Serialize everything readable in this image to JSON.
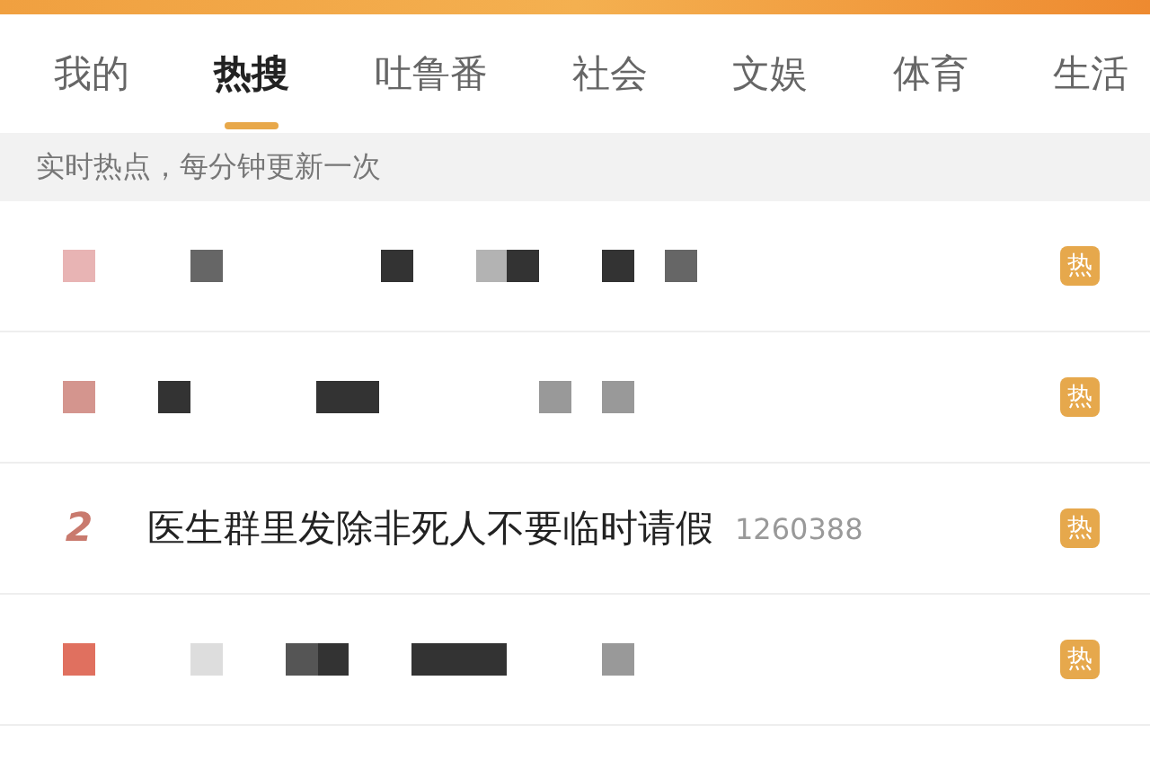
{
  "tabs": [
    {
      "label": "我的",
      "selected": false
    },
    {
      "label": "热搜",
      "selected": true
    },
    {
      "label": "吐鲁番",
      "selected": false
    },
    {
      "label": "社会",
      "selected": false
    },
    {
      "label": "文娱",
      "selected": false
    },
    {
      "label": "体育",
      "selected": false
    },
    {
      "label": "生活",
      "selected": false
    }
  ],
  "banner": "实时热点，每分钟更新一次",
  "rows": [
    {
      "kind": "redacted",
      "color": "#e8b4b4",
      "badge": "热"
    },
    {
      "kind": "redacted",
      "color": "#d4958e",
      "badge": "热"
    },
    {
      "kind": "entry",
      "rank": "2",
      "title": "医生群里发除非死人不要临时请假",
      "count": "1260388",
      "badge": "热"
    },
    {
      "kind": "redacted",
      "color": "#e0705f",
      "badge": "热"
    }
  ]
}
